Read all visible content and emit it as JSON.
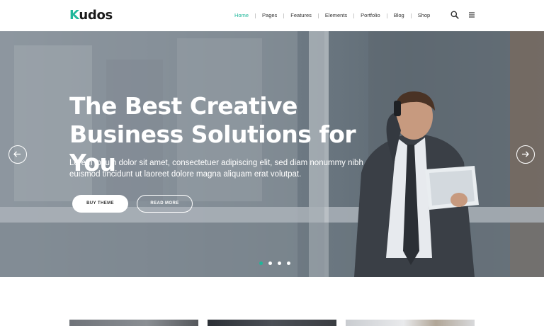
{
  "header": {
    "logo_initial": "K",
    "logo_rest": "udos",
    "nav": [
      {
        "label": "Home",
        "active": true
      },
      {
        "label": "Pages",
        "active": false
      },
      {
        "label": "Features",
        "active": false
      },
      {
        "label": "Elements",
        "active": false
      },
      {
        "label": "Portfolio",
        "active": false
      },
      {
        "label": "Blog",
        "active": false
      },
      {
        "label": "Shop",
        "active": false
      }
    ],
    "icons": [
      "search-icon",
      "hamburger-menu-icon"
    ]
  },
  "hero": {
    "title_line1": "The Best Creative",
    "title_line2": "Business Solutions for You",
    "subtitle_line1": "Lorem ipsum dolor sit amet, consectetuer adipiscing elit, sed diam nonummy nibh",
    "subtitle_line2": "euismod tincidunt ut laoreet dolore magna aliquam erat volutpat.",
    "primary_button": "BUY THEME",
    "secondary_button": "READ MORE",
    "slide_count": 4,
    "active_slide": 1,
    "icons": [
      "arrow-left-icon",
      "arrow-right-icon"
    ]
  },
  "colors": {
    "accent": "#1fb79a",
    "text_dark": "#333333",
    "white": "#ffffff"
  }
}
